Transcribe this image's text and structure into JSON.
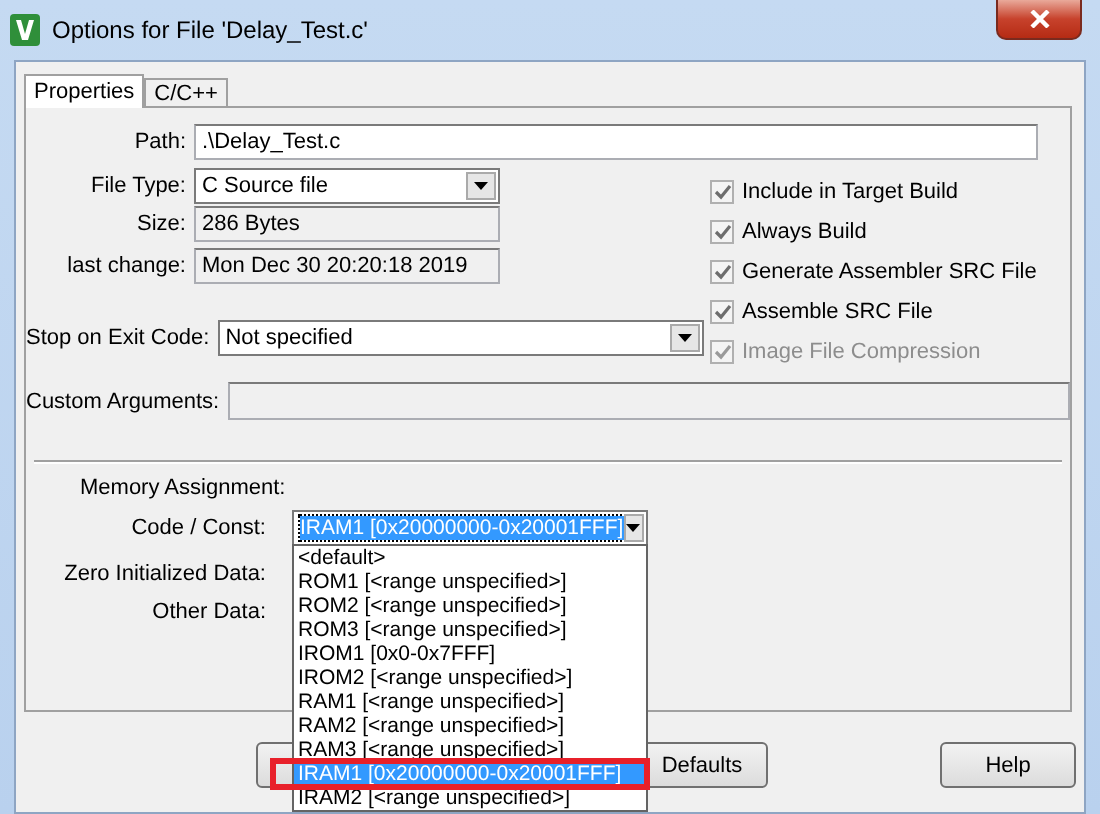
{
  "window": {
    "title": "Options for File 'Delay_Test.c'"
  },
  "tabs": [
    {
      "label": "Properties",
      "selected": true
    },
    {
      "label": "C/C++",
      "selected": false
    }
  ],
  "path": {
    "label": "Path:",
    "value": ".\\Delay_Test.c"
  },
  "file_type": {
    "label": "File Type:",
    "value": "C Source file"
  },
  "size": {
    "label": "Size:",
    "value": "286 Bytes"
  },
  "last_change": {
    "label": "last change:",
    "value": "Mon Dec 30 20:20:18 2019"
  },
  "stop_on_exit": {
    "label": "Stop on Exit Code:",
    "value": "Not specified"
  },
  "custom_arguments": {
    "label": "Custom Arguments:"
  },
  "checkboxes": [
    {
      "label": "Include in Target Build",
      "checked": true,
      "disabled": false
    },
    {
      "label": "Always Build",
      "checked": true,
      "disabled": false
    },
    {
      "label": "Generate Assembler SRC File",
      "checked": true,
      "disabled": false
    },
    {
      "label": "Assemble SRC File",
      "checked": true,
      "disabled": false
    },
    {
      "label": "Image File Compression",
      "checked": true,
      "disabled": true
    }
  ],
  "memory": {
    "title": "Memory Assignment:",
    "code_const": {
      "label": "Code / Const:",
      "value": "IRAM1 [0x20000000-0x20001FFF]"
    },
    "zero_init_label": "Zero Initialized Data:",
    "other_data_label": "Other Data:"
  },
  "dropdown_items": [
    {
      "label": "<default>",
      "selected": false,
      "highlighted": false
    },
    {
      "label": "ROM1 [<range unspecified>]",
      "selected": false,
      "highlighted": false
    },
    {
      "label": "ROM2 [<range unspecified>]",
      "selected": false,
      "highlighted": false
    },
    {
      "label": "ROM3 [<range unspecified>]",
      "selected": false,
      "highlighted": false
    },
    {
      "label": "IROM1 [0x0-0x7FFF]",
      "selected": false,
      "highlighted": false
    },
    {
      "label": "IROM2 [<range unspecified>]",
      "selected": false,
      "highlighted": false
    },
    {
      "label": "RAM1 [<range unspecified>]",
      "selected": false,
      "highlighted": false
    },
    {
      "label": "RAM2 [<range unspecified>]",
      "selected": false,
      "highlighted": false
    },
    {
      "label": "RAM3 [<range unspecified>]",
      "selected": false,
      "highlighted": false
    },
    {
      "label": "IRAM1 [0x20000000-0x20001FFF]",
      "selected": true,
      "highlighted": true
    },
    {
      "label": "IRAM2 [<range unspecified>]",
      "selected": false,
      "highlighted": false
    }
  ],
  "buttons": [
    "Defaults",
    "Help"
  ]
}
